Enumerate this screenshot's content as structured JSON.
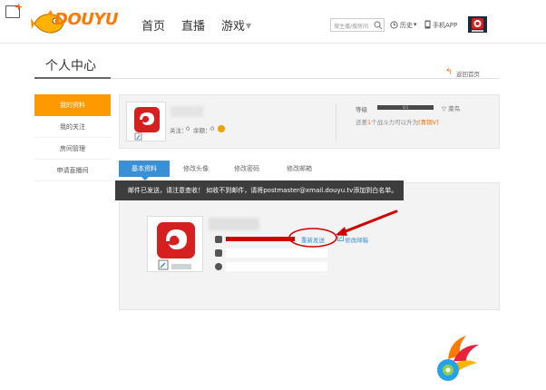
{
  "header": {
    "logo_text": "DOUYU",
    "nav": [
      {
        "label": "首页"
      },
      {
        "label": "直播"
      },
      {
        "label": "游戏"
      }
    ],
    "nav_dropdown_glyph": "▼",
    "search": {
      "placeholder": "搜主播/搜房间"
    },
    "history_label": "历史",
    "history_glyph": "▾",
    "app_label": "手机APP"
  },
  "sidebar": {
    "title": "个人中心",
    "items": [
      {
        "label": "我的资料"
      },
      {
        "label": "我的关注"
      },
      {
        "label": "房间管理"
      },
      {
        "label": "申请直播间"
      }
    ]
  },
  "back_link": "返回首页",
  "profile": {
    "follow_label": "关注：",
    "follow_value": "0",
    "balance_label": "余额：",
    "balance_value": "0",
    "level_label": "等级",
    "level_bar_text": "0/1",
    "level_tail": "▽ 菜鸟",
    "level_hint_prefix": "还差",
    "level_hint_num": "1",
    "level_hint_suffix": "个战斗力可以升为",
    "level_hint_next": "[青铜V]"
  },
  "tabs": [
    {
      "label": "基本资料"
    },
    {
      "label": "修改头像"
    },
    {
      "label": "修改密码"
    },
    {
      "label": "修改邮箱"
    }
  ],
  "notice": "邮件已发送，请注意查收！ 如收不到邮件，请将postmaster@xmail.douyu.tv添加到白名单。",
  "form": {
    "resend_label": "重新发送",
    "edit_email_label": "修改邮箱"
  },
  "colors": {
    "accent": "#ff9900",
    "tab_active": "#3b8fd5",
    "notice_bg": "#3d3d3d",
    "annotation": "#d10000"
  }
}
